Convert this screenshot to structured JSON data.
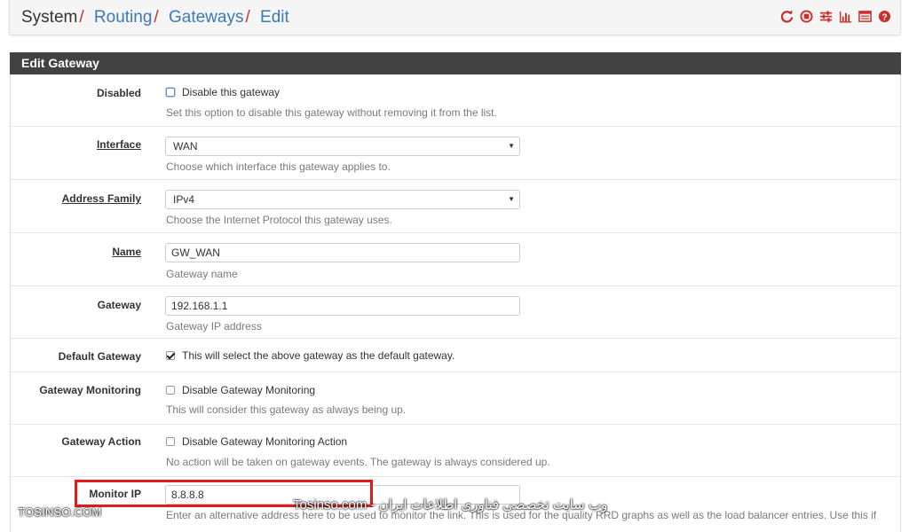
{
  "breadcrumb": {
    "root": "System",
    "items": [
      "Routing",
      "Gateways",
      "Edit"
    ],
    "separator": "/"
  },
  "header_icons": [
    "reload-icon",
    "stop-icon",
    "sliders-icon",
    "bar-chart-icon",
    "list-icon",
    "help-icon"
  ],
  "panel": {
    "title": "Edit Gateway"
  },
  "form": {
    "disabled": {
      "label": "Disabled",
      "checkbox_label": "Disable this gateway",
      "checked": false,
      "help": "Set this option to disable this gateway without removing it from the list."
    },
    "interface": {
      "label": "Interface",
      "value": "WAN",
      "help": "Choose which interface this gateway applies to."
    },
    "address_family": {
      "label": "Address Family",
      "value": "IPv4",
      "help": "Choose the Internet Protocol this gateway uses."
    },
    "name": {
      "label": "Name",
      "value": "GW_WAN",
      "help": "Gateway name"
    },
    "gateway": {
      "label": "Gateway",
      "value": "192.168.1.1",
      "help": "Gateway IP address"
    },
    "default_gateway": {
      "label": "Default Gateway",
      "checkbox_label": "This will select the above gateway as the default gateway.",
      "checked": true
    },
    "gateway_monitoring": {
      "label": "Gateway Monitoring",
      "checkbox_label": "Disable Gateway Monitoring",
      "checked": false,
      "help": "This will consider this gateway as always being up."
    },
    "gateway_action": {
      "label": "Gateway Action",
      "checkbox_label": "Disable Gateway Monitoring Action",
      "checked": false,
      "help": "No action will be taken on gateway events. The gateway is always considered up."
    },
    "monitor_ip": {
      "label": "Monitor IP",
      "value": "8.8.8.8",
      "help": "Enter an alternative address here to be used to monitor the link. This is used for the quality RRD graphs as well as the load balancer entries. Use this if"
    }
  },
  "watermarks": {
    "left": "TOSINSO.COM",
    "right": "Tosinso.com - وب سایت تخصصی فناوری اطلاعات ایران"
  },
  "colors": {
    "panel_heading": "#424242",
    "link": "#3b79b8",
    "separator": "#c9302c",
    "highlight": "#e01b1b"
  }
}
